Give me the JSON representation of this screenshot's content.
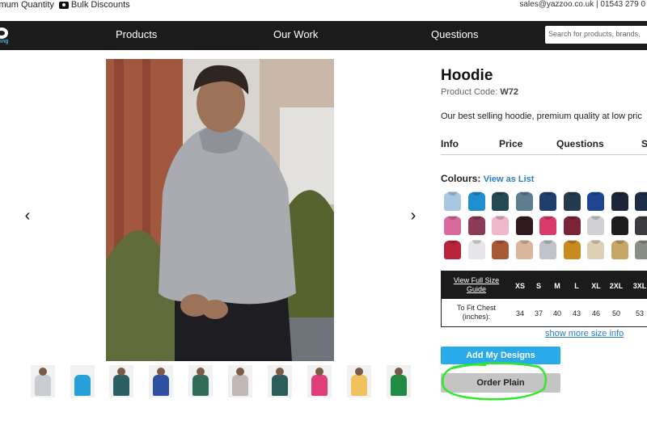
{
  "topbar": {
    "left_text_1": "imum Quantity",
    "left_text_2": "Bulk Discounts",
    "right_text": "sales@yazzoo.co.uk | 01543 279 0"
  },
  "nav": {
    "logo_sub": "ing",
    "items": [
      "Products",
      "Our Work",
      "Questions"
    ],
    "search_placeholder": "Search for products, brands,"
  },
  "gallery": {
    "prev_label": "‹",
    "next_label": "›",
    "thumb_colors": [
      "#c9ccd2",
      "#27a0d8",
      "#2c5f63",
      "#2f4fa3",
      "#316b5a",
      "#c3b7b6",
      "#2b5c5a",
      "#e23d7b",
      "#f0c25e",
      "#1f8a43"
    ]
  },
  "product": {
    "title": "Hoodie",
    "code_label": "Product Code:",
    "code_value": "W72",
    "description": "Our best selling hoodie, premium quality at low pric",
    "tabs": [
      "Info",
      "Price",
      "Questions",
      "S"
    ]
  },
  "colours": {
    "label": "Colours:",
    "view_list": "View as List",
    "swatches": [
      "#a9c7e0",
      "#1d8fd1",
      "#234a50",
      "#5d7f8f",
      "#1f3e6d",
      "#223b4f",
      "#1e4592",
      "#1c2638",
      "#1c2c47",
      "#d76a9c",
      "#8c3b57",
      "#f0b7ca",
      "#2f1a1f",
      "#d93c69",
      "#7a2436",
      "#d1d1d5",
      "#1d1d1f",
      "#3c3c3f",
      "#b8233a",
      "#e6e6ea",
      "#a85a34",
      "#d9b79d",
      "#c1c3c9",
      "#c98a1e",
      "#ddd1b5",
      "#c6a665",
      "#8a8f86"
    ]
  },
  "size_guide": {
    "guide_link": "View Full Size Guide",
    "sizes": [
      "XS",
      "S",
      "M",
      "L",
      "XL",
      "2XL",
      "3XL"
    ],
    "row_label": "To Fit Chest (inches):",
    "values": [
      "34",
      "37",
      "40",
      "43",
      "46",
      "50",
      "53"
    ],
    "more_link": "show more size info"
  },
  "actions": {
    "add_designs": "Add My Designs",
    "order_plain": "Order Plain"
  },
  "colors": {
    "nav_bg": "#1b1b1b",
    "accent_blue": "#29aaeb",
    "annotation_green": "#2ee82e"
  }
}
